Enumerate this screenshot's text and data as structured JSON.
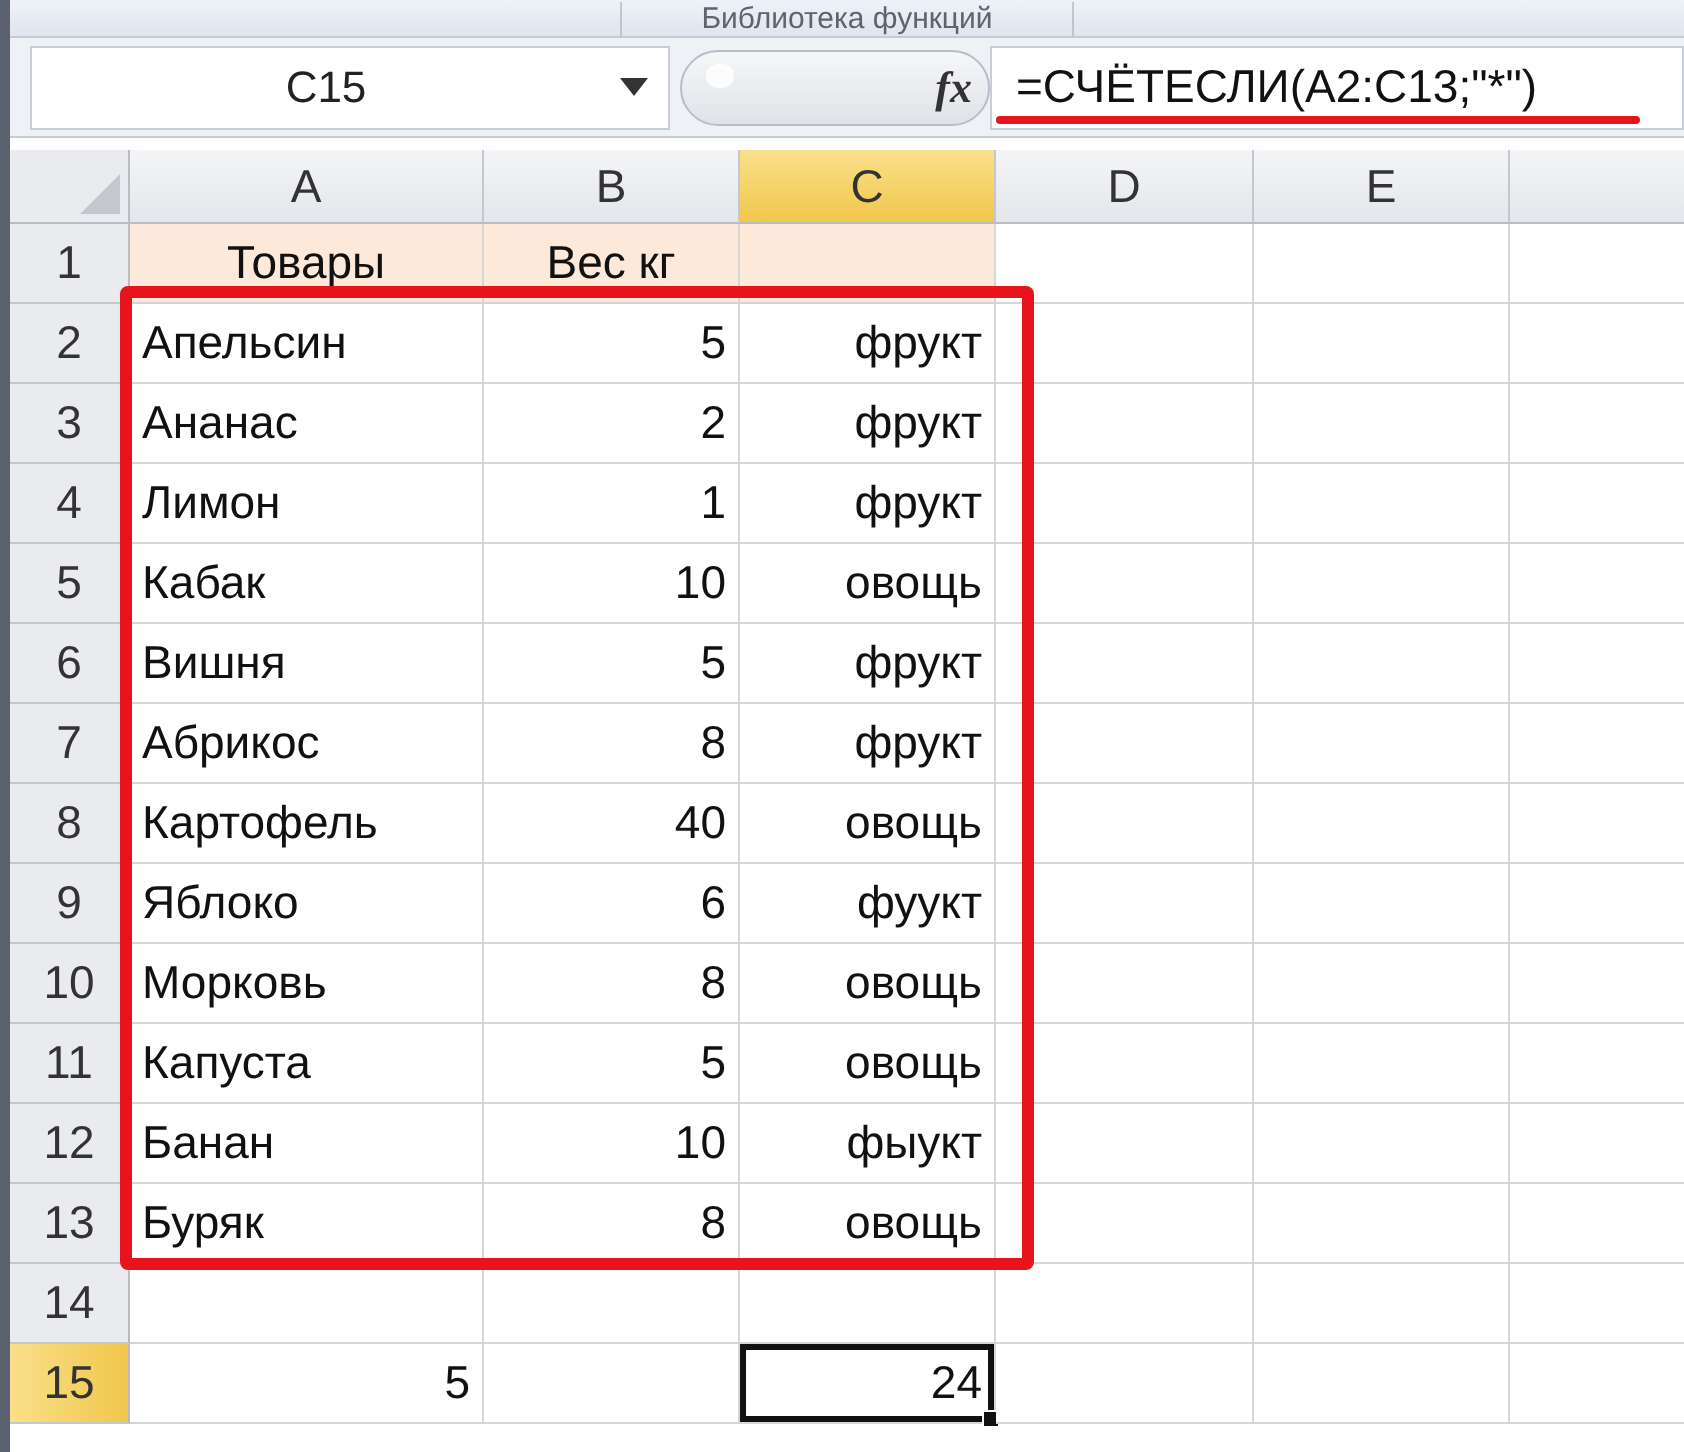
{
  "ribbon_group": "Библиотека функций",
  "name_box": "C15",
  "function_button": "fx",
  "formula": "=СЧЁТЕСЛИ(A2:C13;\"*\")",
  "columns": [
    {
      "label": "A",
      "selected": false
    },
    {
      "label": "B",
      "selected": false
    },
    {
      "label": "C",
      "selected": true
    },
    {
      "label": "D",
      "selected": false
    },
    {
      "label": "E",
      "selected": false
    }
  ],
  "rows": [
    {
      "number": "1",
      "kind": "header",
      "selected": false,
      "cells": [
        "Товары",
        "Вес кг",
        null
      ]
    },
    {
      "number": "2",
      "kind": "data",
      "selected": false,
      "cells": [
        "Апельсин",
        "5",
        "фрукт"
      ]
    },
    {
      "number": "3",
      "kind": "data",
      "selected": false,
      "cells": [
        "Ананас",
        "2",
        "фрукт"
      ]
    },
    {
      "number": "4",
      "kind": "data",
      "selected": false,
      "cells": [
        "Лимон",
        "1",
        "фрукт"
      ]
    },
    {
      "number": "5",
      "kind": "data",
      "selected": false,
      "cells": [
        "Кабак",
        "10",
        "овощь"
      ]
    },
    {
      "number": "6",
      "kind": "data",
      "selected": false,
      "cells": [
        "Вишня",
        "5",
        "фрукт"
      ]
    },
    {
      "number": "7",
      "kind": "data",
      "selected": false,
      "cells": [
        "Абрикос",
        "8",
        "фрукт"
      ]
    },
    {
      "number": "8",
      "kind": "data",
      "selected": false,
      "cells": [
        "Картофель",
        "40",
        "овощь"
      ]
    },
    {
      "number": "9",
      "kind": "data",
      "selected": false,
      "cells": [
        "Яблоко",
        "6",
        "фуукт"
      ]
    },
    {
      "number": "10",
      "kind": "data",
      "selected": false,
      "cells": [
        "Морковь",
        "8",
        "овощь"
      ]
    },
    {
      "number": "11",
      "kind": "data",
      "selected": false,
      "cells": [
        "Капуста",
        "5",
        "овощь"
      ]
    },
    {
      "number": "12",
      "kind": "data",
      "selected": false,
      "cells": [
        "Банан",
        "10",
        "фыукт"
      ]
    },
    {
      "number": "13",
      "kind": "data",
      "selected": false,
      "cells": [
        "Буряк",
        "8",
        "овощь"
      ]
    },
    {
      "number": "14",
      "kind": "blank",
      "selected": false
    },
    {
      "number": "15",
      "kind": "total",
      "selected": true,
      "cells": [
        "5",
        null,
        "24"
      ]
    }
  ]
}
